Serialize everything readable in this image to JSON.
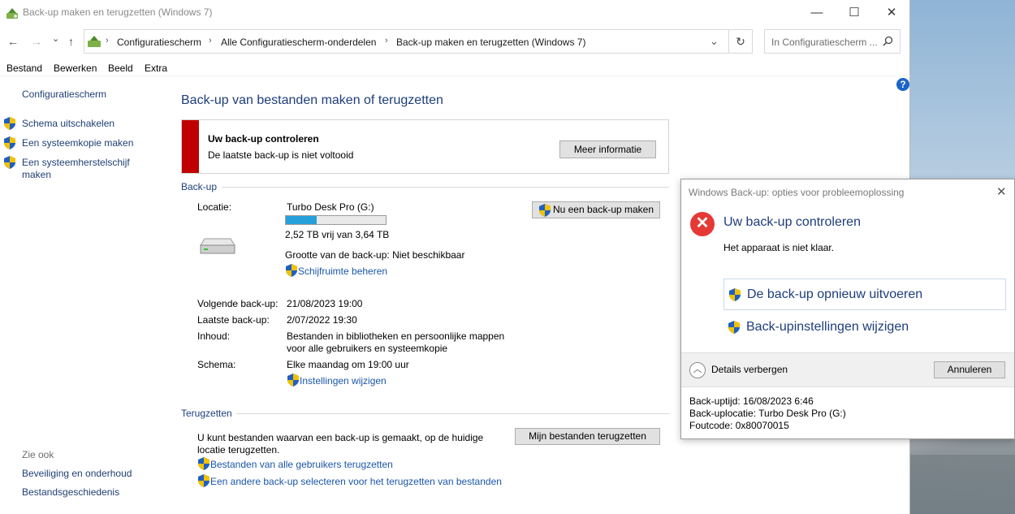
{
  "window": {
    "title": "Back-up maken en terugzetten (Windows 7)",
    "min": "—",
    "max": "☐",
    "close": "✕"
  },
  "nav": {
    "back": "←",
    "forward": "→",
    "recent": "⌄",
    "up": "↑"
  },
  "address": {
    "crumbs": [
      "Configuratiescherm",
      "Alle Configuratiescherm-onderdelen",
      "Back-up maken en terugzetten (Windows 7)"
    ],
    "dropdown": "⌄",
    "refresh": "↻"
  },
  "search": {
    "placeholder": "In Configuratiescherm ..."
  },
  "menu": [
    "Bestand",
    "Bewerken",
    "Beeld",
    "Extra"
  ],
  "help": "?",
  "sidebar": {
    "home": "Configuratiescherm",
    "tasks": [
      "Schema uitschakelen",
      "Een systeemkopie maken",
      "Een systeemherstelschijf",
      "maken"
    ],
    "see_also": "Zie ook",
    "see_also_links": [
      "Beveiliging en onderhoud",
      "Bestandsgeschiedenis"
    ]
  },
  "main": {
    "heading": "Back-up van bestanden maken of terugzetten",
    "alert": {
      "title": "Uw back-up controleren",
      "message": "De laatste back-up is niet voltooid",
      "button": "Meer informatie"
    },
    "backup": {
      "section": "Back-up",
      "location_label": "Locatie:",
      "location_value": "Turbo Desk Pro (G:)",
      "usage_fraction": 0.31,
      "free_space": "2,52 TB vrij van 3,64 TB",
      "size": "Grootte van de back-up: Niet beschikbaar",
      "manage_space": "Schijfruimte beheren",
      "backup_now": "Nu een back-up maken",
      "next_label": "Volgende back-up:",
      "next_value": "21/08/2023 19:00",
      "last_label": "Laatste back-up:",
      "last_value": "2/07/2022 19:30",
      "contents_label": "Inhoud:",
      "contents_value_1": "Bestanden in bibliotheken en persoonlijke mappen",
      "contents_value_2": "voor alle gebruikers en systeemkopie",
      "schedule_label": "Schema:",
      "schedule_value": "Elke maandag om 19:00 uur",
      "change_settings": "Instellingen wijzigen"
    },
    "restore": {
      "section": "Terugzetten",
      "text_1": "U kunt bestanden waarvan een back-up is gemaakt, op de huidige",
      "text_2": "locatie terugzetten.",
      "button": "Mijn bestanden terugzetten",
      "link_all_users": "Bestanden van alle gebruikers terugzetten",
      "link_other_backup": "Een andere back-up selecteren voor het terugzetten van bestanden"
    }
  },
  "dialog": {
    "title": "Windows Back-up: opties voor probleemoplossing",
    "close": "✕",
    "heading": "Uw back-up controleren",
    "message": "Het apparaat is niet klaar.",
    "cmd_retry": "De back-up opnieuw uitvoeren",
    "cmd_settings": "Back-upinstellingen wijzigen",
    "details_toggle": "Details verbergen",
    "cancel": "Annuleren",
    "details": [
      "Back-uptijd: 16/08/2023 6:46",
      "Back-uplocatie: Turbo Desk Pro (G:)",
      "Foutcode: 0x80070015"
    ]
  }
}
